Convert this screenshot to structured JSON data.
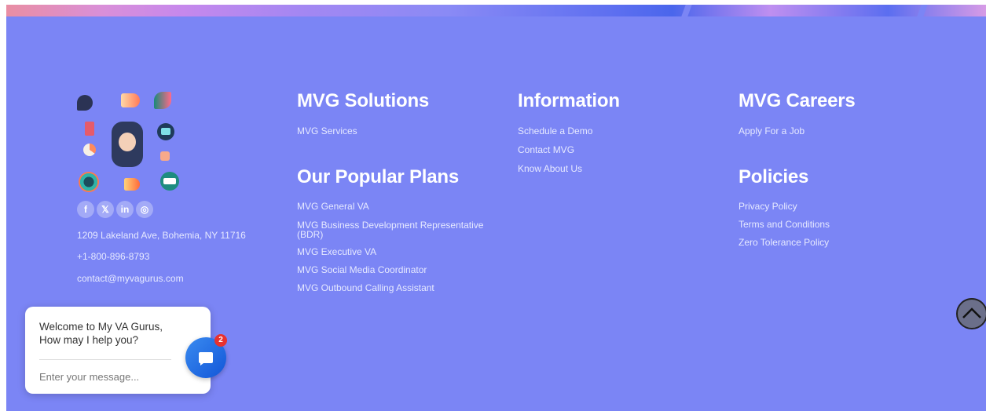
{
  "contact": {
    "address": "1209 Lakeland Ave, Bohemia, NY 11716",
    "phone": "+1-800-896-8793",
    "email": "contact@myvagurus.com"
  },
  "social": [
    {
      "icon": "facebook-icon",
      "glyph": "f"
    },
    {
      "icon": "x-icon",
      "glyph": "𝕏"
    },
    {
      "icon": "linkedin-icon",
      "glyph": "in"
    },
    {
      "icon": "instagram-icon",
      "glyph": "◎"
    }
  ],
  "solutions": {
    "heading": "MVG Solutions",
    "links": [
      "MVG Services"
    ]
  },
  "plans": {
    "heading": "Our Popular Plans",
    "links": [
      "MVG General VA",
      "MVG Business Development Representative (BDR)",
      "MVG Executive VA",
      "MVG Social Media Coordinator",
      "MVG Outbound Calling Assistant"
    ]
  },
  "information": {
    "heading": "Information",
    "links": [
      "Schedule a Demo",
      "Contact MVG",
      "Know About Us"
    ]
  },
  "careers": {
    "heading": "MVG Careers",
    "links": [
      "Apply For a Job"
    ]
  },
  "policies": {
    "heading": "Policies",
    "links": [
      "Privacy Policy",
      "Terms and Conditions",
      "Zero Tolerance Policy"
    ]
  },
  "chat": {
    "welcome": "Welcome to My VA Gurus, How may I help you?",
    "placeholder": "Enter your message...",
    "badge": "2"
  },
  "colors": {
    "footer_bg": "#7b85f5",
    "chat_button": "#1f6fe6",
    "badge": "#e8322f"
  }
}
